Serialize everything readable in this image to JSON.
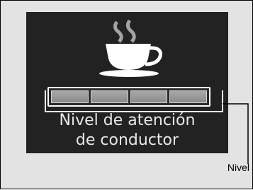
{
  "display": {
    "line1": "Nivel de atención",
    "line2": "de conductor",
    "icon": "coffee-cup-icon",
    "level_segments_filled": 4,
    "level_segments_total": 4
  },
  "callout": {
    "label": "Nivel"
  }
}
